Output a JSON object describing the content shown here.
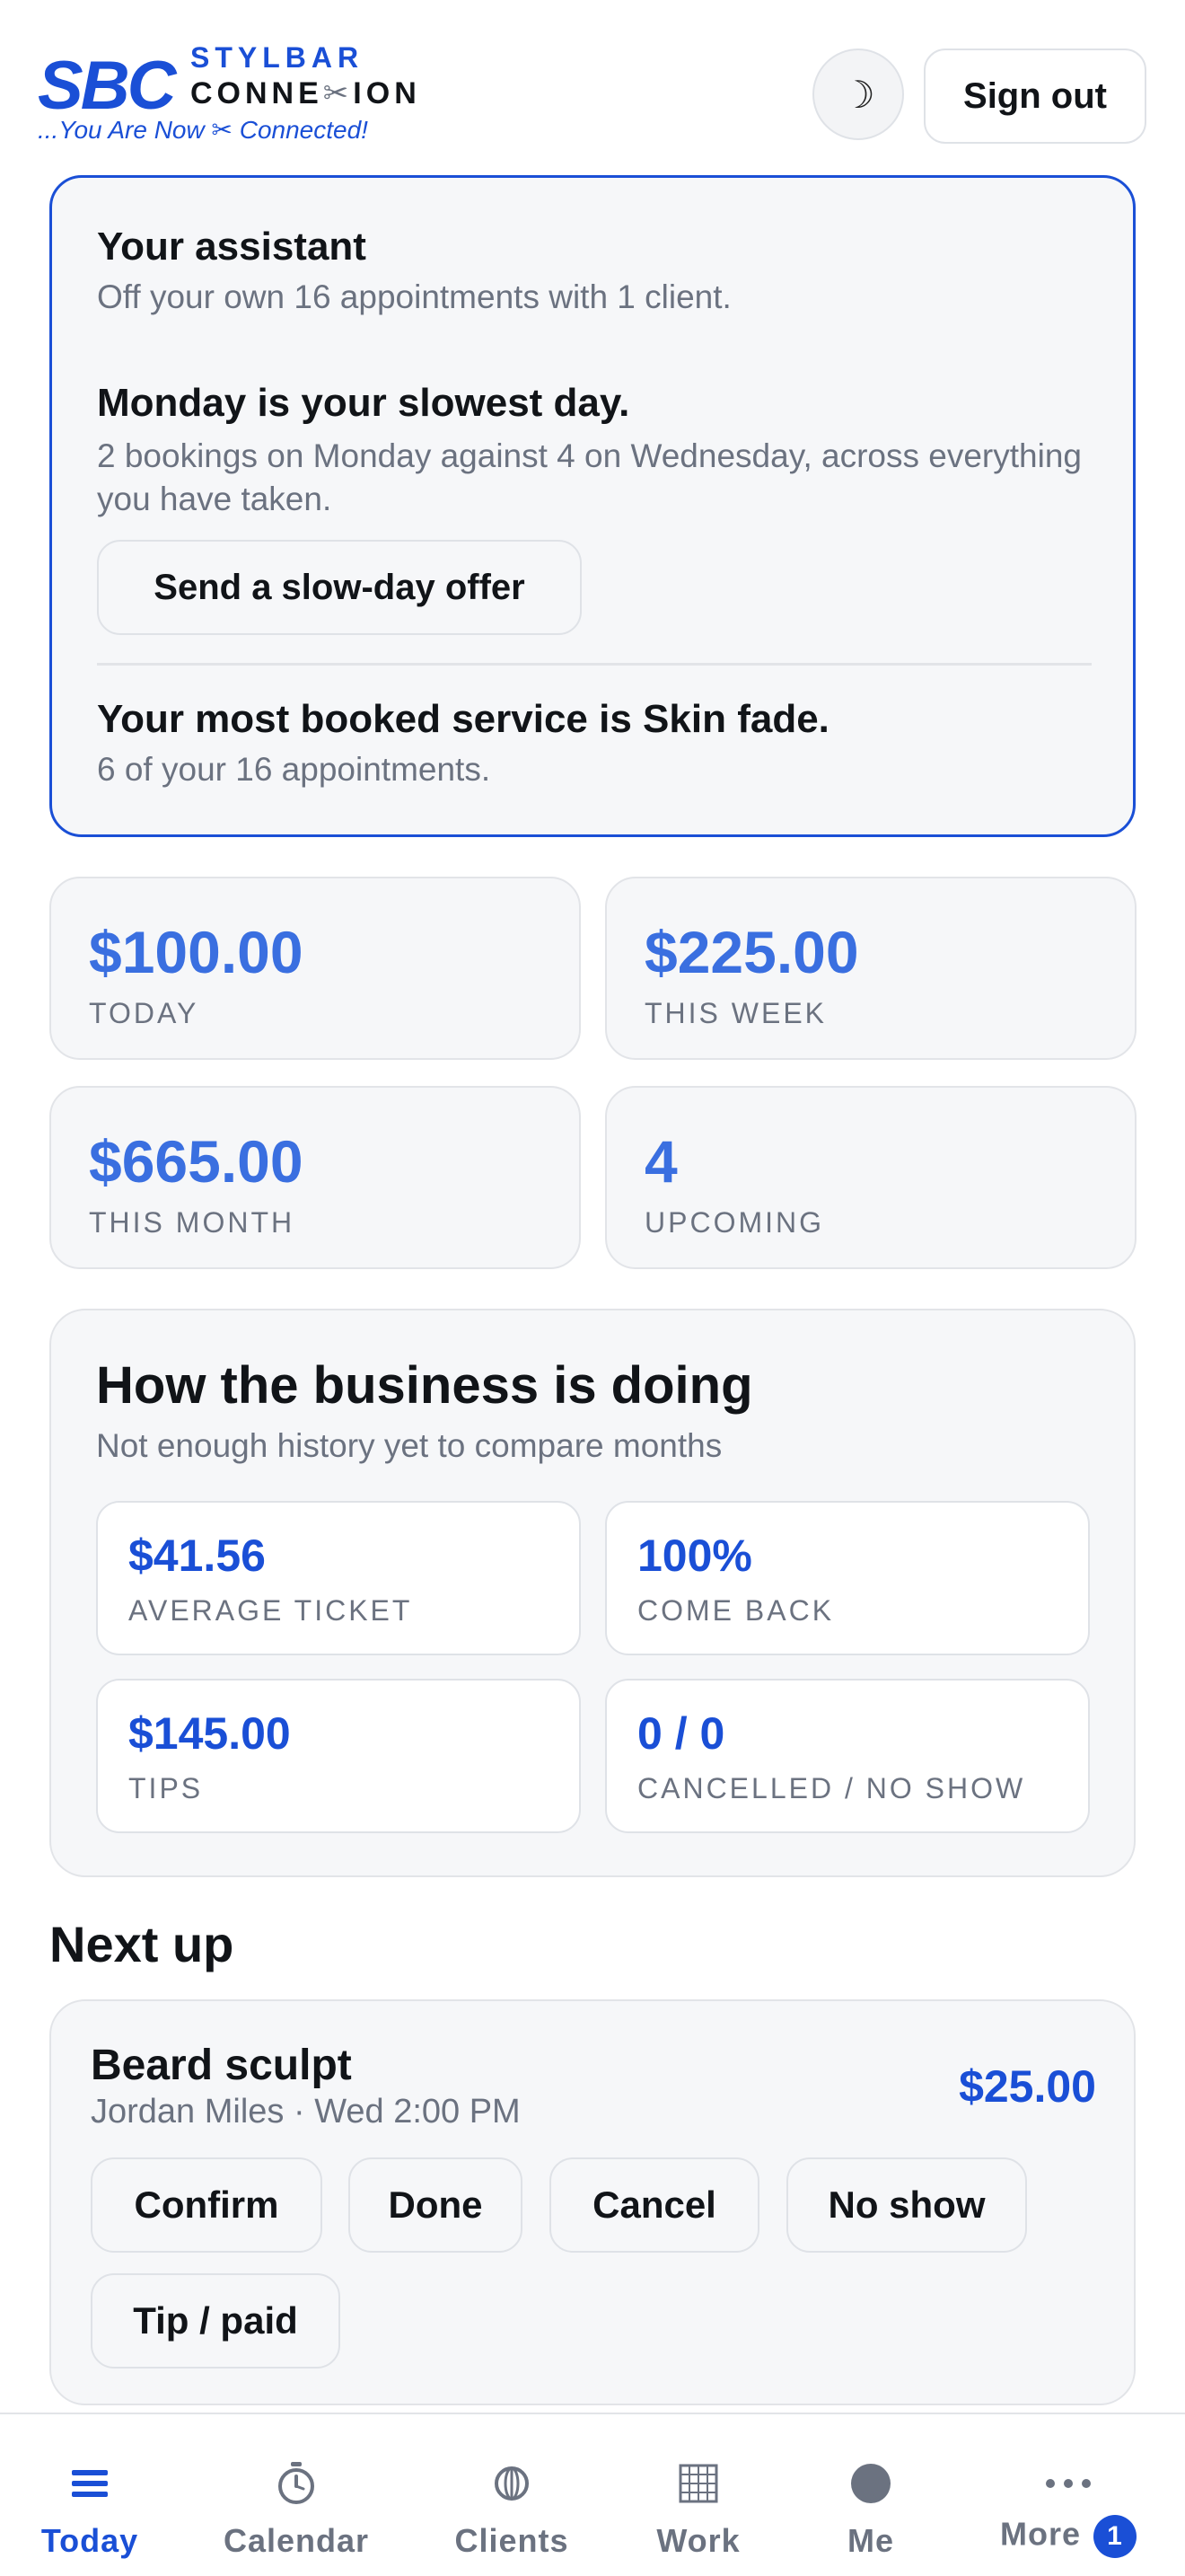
{
  "brand": {
    "short": "SBC",
    "line1": "STYLBAR",
    "line2_part1": "CONNE",
    "line2_scissor": "✂",
    "line2_part2": "ION",
    "tagline": "...You Are Now ✂ Connected!"
  },
  "header": {
    "theme_toggle_icon": "☽",
    "signout_label": "Sign out"
  },
  "assistant": {
    "title": "Your assistant",
    "subtitle": "Off your own 16 appointments with 1 client.",
    "insight1_heading": "Monday is your slowest day.",
    "insight1_text": "2 bookings on Monday against 4 on Wednesday, across everything you have taken.",
    "offer_button": "Send a slow-day offer",
    "insight2_heading": "Your most booked service is Skin fade.",
    "insight2_text": "6 of your 16 appointments."
  },
  "stats": [
    {
      "value": "$100.00",
      "label": "TODAY"
    },
    {
      "value": "$225.00",
      "label": "THIS WEEK"
    },
    {
      "value": "$665.00",
      "label": "THIS MONTH"
    },
    {
      "value": "4",
      "label": "UPCOMING"
    }
  ],
  "business": {
    "title": "How the business is doing",
    "subtitle": "Not enough history yet to compare months",
    "metrics": [
      {
        "value": "$41.56",
        "label": "AVERAGE TICKET"
      },
      {
        "value": "100%",
        "label": "COME BACK"
      },
      {
        "value": "$145.00",
        "label": "TIPS"
      },
      {
        "value": "0 / 0",
        "label": "CANCELLED / NO SHOW"
      }
    ]
  },
  "next_up": {
    "title": "Next up",
    "appointment": {
      "service": "Beard sculpt",
      "meta": "Jordan Miles · Wed 2:00 PM",
      "price": "$25.00",
      "actions": [
        "Confirm",
        "Done",
        "Cancel",
        "No show",
        "Tip / paid"
      ]
    }
  },
  "nav": {
    "items": [
      {
        "label": "Today",
        "icon": "list-icon",
        "active": true
      },
      {
        "label": "Calendar",
        "icon": "stopwatch-icon"
      },
      {
        "label": "Clients",
        "icon": "globe-icon"
      },
      {
        "label": "Work",
        "icon": "grid-icon"
      },
      {
        "label": "Me",
        "icon": "avatar-icon"
      },
      {
        "label": "More",
        "icon": "ellipsis-icon",
        "badge": "1"
      }
    ]
  },
  "colors": {
    "accent": "#1a4fd6",
    "stat_value": "#3a6fe0",
    "muted_text": "#6b7280",
    "card_bg": "#f6f7f9",
    "border": "#e2e4e8"
  }
}
